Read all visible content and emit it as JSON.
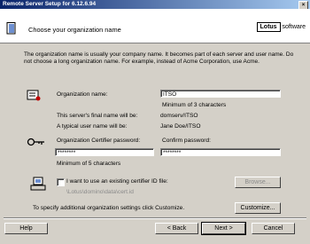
{
  "window": {
    "title": "Remote Server Setup for 6.12.6.94",
    "close_label": "×"
  },
  "header": {
    "title": "Choose your organization name",
    "logo_brand": "Lotus",
    "logo_word": "software"
  },
  "description": "The organization name is usually your company name. It becomes part of each server and user name. Do not choose a long organization name. For example, instead of Acme Corporation, use Acme.",
  "org": {
    "label": "Organization name:",
    "value": "ITSO",
    "hint": "Minimum of 3 characters",
    "final_name_label": "This server's final name will be:",
    "final_name_value": "domserv/ITSO",
    "user_name_label": "A typical user name will be:",
    "user_name_value": "Jane Doe/ITSO"
  },
  "certifier": {
    "password_label": "Organization Certifier password:",
    "password_value": "********",
    "confirm_label": "Confirm password:",
    "confirm_value": "********",
    "hint": "Minimum of 5 characters"
  },
  "existing_id": {
    "checkbox_label": "I want to use an existing certifier ID file:",
    "path_placeholder": "\\Lotus\\domino\\data\\cert.id",
    "browse_label": "Browse..."
  },
  "customize": {
    "text": "To specify additional organization settings click Customize.",
    "button_label": "Customize..."
  },
  "footer": {
    "help_label": "Help",
    "back_label": "< Back",
    "next_label": "Next >",
    "cancel_label": "Cancel"
  }
}
